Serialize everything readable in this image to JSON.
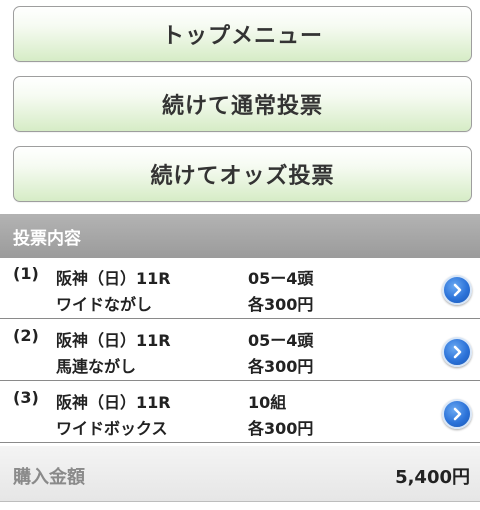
{
  "buttons": {
    "top_menu": "トップメニュー",
    "continue_normal": "続けて通常投票",
    "continue_odds": "続けてオッズ投票"
  },
  "section": {
    "title": "投票内容"
  },
  "bets": [
    {
      "index": "(1)",
      "race": "阪神（日）11R",
      "bet_type": "ワイドながし",
      "selection": "05ー4頭",
      "amount": "各300円",
      "arrow_icon": "chevron-right-circle-icon"
    },
    {
      "index": "(2)",
      "race": "阪神（日）11R",
      "bet_type": "馬連ながし",
      "selection": "05ー4頭",
      "amount": "各300円",
      "arrow_icon": "chevron-right-circle-icon"
    },
    {
      "index": "(3)",
      "race": "阪神（日）11R",
      "bet_type": "ワイドボックス",
      "selection": "10組",
      "amount": "各300円",
      "arrow_icon": "chevron-right-circle-icon"
    }
  ],
  "total": {
    "label": "購入金額",
    "value": "5,400円"
  },
  "colors": {
    "button_gradient_bottom": "#d6ecc6",
    "header_bg": "#9b9b9b",
    "arrow_blue": "#2c73d9"
  }
}
